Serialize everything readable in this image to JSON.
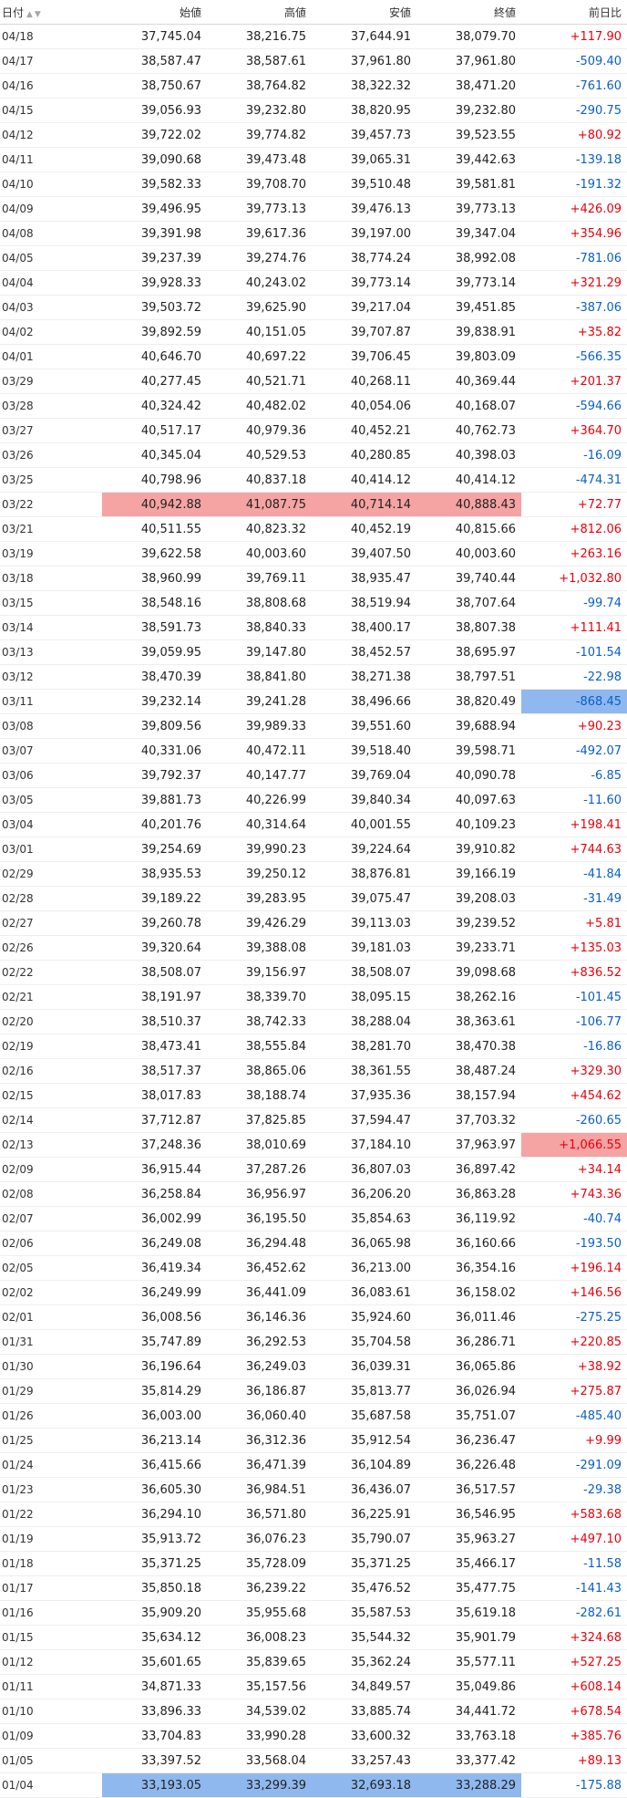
{
  "table": {
    "headers": {
      "date": "日付",
      "sort_icon": "▲▼",
      "open": "始値",
      "high": "高値",
      "low": "安値",
      "close": "終値",
      "change": "前日比"
    },
    "rows": [
      {
        "date": "04/18",
        "open": "37,745.04",
        "high": "38,216.75",
        "low": "37,644.91",
        "close": "38,079.70",
        "change": "+117.90"
      },
      {
        "date": "04/17",
        "open": "38,587.47",
        "high": "38,587.61",
        "low": "37,961.80",
        "close": "37,961.80",
        "change": "-509.40"
      },
      {
        "date": "04/16",
        "open": "38,750.67",
        "high": "38,764.82",
        "low": "38,322.32",
        "close": "38,471.20",
        "change": "-761.60"
      },
      {
        "date": "04/15",
        "open": "39,056.93",
        "high": "39,232.80",
        "low": "38,820.95",
        "close": "39,232.80",
        "change": "-290.75"
      },
      {
        "date": "04/12",
        "open": "39,722.02",
        "high": "39,774.82",
        "low": "39,457.73",
        "close": "39,523.55",
        "change": "+80.92"
      },
      {
        "date": "04/11",
        "open": "39,090.68",
        "high": "39,473.48",
        "low": "39,065.31",
        "close": "39,442.63",
        "change": "-139.18"
      },
      {
        "date": "04/10",
        "open": "39,582.33",
        "high": "39,708.70",
        "low": "39,510.48",
        "close": "39,581.81",
        "change": "-191.32"
      },
      {
        "date": "04/09",
        "open": "39,496.95",
        "high": "39,773.13",
        "low": "39,476.13",
        "close": "39,773.13",
        "change": "+426.09"
      },
      {
        "date": "04/08",
        "open": "39,391.98",
        "high": "39,617.36",
        "low": "39,197.00",
        "close": "39,347.04",
        "change": "+354.96"
      },
      {
        "date": "04/05",
        "open": "39,237.39",
        "high": "39,274.76",
        "low": "38,774.24",
        "close": "38,992.08",
        "change": "-781.06"
      },
      {
        "date": "04/04",
        "open": "39,928.33",
        "high": "40,243.02",
        "low": "39,773.14",
        "close": "39,773.14",
        "change": "+321.29"
      },
      {
        "date": "04/03",
        "open": "39,503.72",
        "high": "39,625.90",
        "low": "39,217.04",
        "close": "39,451.85",
        "change": "-387.06"
      },
      {
        "date": "04/02",
        "open": "39,892.59",
        "high": "40,151.05",
        "low": "39,707.87",
        "close": "39,838.91",
        "change": "+35.82"
      },
      {
        "date": "04/01",
        "open": "40,646.70",
        "high": "40,697.22",
        "low": "39,706.45",
        "close": "39,803.09",
        "change": "-566.35"
      },
      {
        "date": "03/29",
        "open": "40,277.45",
        "high": "40,521.71",
        "low": "40,268.11",
        "close": "40,369.44",
        "change": "+201.37"
      },
      {
        "date": "03/28",
        "open": "40,324.42",
        "high": "40,482.02",
        "low": "40,054.06",
        "close": "40,168.07",
        "change": "-594.66"
      },
      {
        "date": "03/27",
        "open": "40,517.17",
        "high": "40,979.36",
        "low": "40,452.21",
        "close": "40,762.73",
        "change": "+364.70"
      },
      {
        "date": "03/26",
        "open": "40,345.04",
        "high": "40,529.53",
        "low": "40,280.85",
        "close": "40,398.03",
        "change": "-16.09"
      },
      {
        "date": "03/25",
        "open": "40,798.96",
        "high": "40,837.18",
        "low": "40,414.12",
        "close": "40,414.12",
        "change": "-474.31"
      },
      {
        "date": "03/22",
        "open": "40,942.88",
        "high": "41,087.75",
        "low": "40,714.14",
        "close": "40,888.43",
        "change": "+72.77",
        "hl_ohlc": "red"
      },
      {
        "date": "03/21",
        "open": "40,511.55",
        "high": "40,823.32",
        "low": "40,452.19",
        "close": "40,815.66",
        "change": "+812.06"
      },
      {
        "date": "03/19",
        "open": "39,622.58",
        "high": "40,003.60",
        "low": "39,407.50",
        "close": "40,003.60",
        "change": "+263.16"
      },
      {
        "date": "03/18",
        "open": "38,960.99",
        "high": "39,769.11",
        "low": "38,935.47",
        "close": "39,740.44",
        "change": "+1,032.80"
      },
      {
        "date": "03/15",
        "open": "38,548.16",
        "high": "38,808.68",
        "low": "38,519.94",
        "close": "38,707.64",
        "change": "-99.74"
      },
      {
        "date": "03/14",
        "open": "38,591.73",
        "high": "38,840.33",
        "low": "38,400.17",
        "close": "38,807.38",
        "change": "+111.41"
      },
      {
        "date": "03/13",
        "open": "39,059.95",
        "high": "39,147.80",
        "low": "38,452.57",
        "close": "38,695.97",
        "change": "-101.54"
      },
      {
        "date": "03/12",
        "open": "38,470.39",
        "high": "38,841.80",
        "low": "38,271.38",
        "close": "38,797.51",
        "change": "-22.98"
      },
      {
        "date": "03/11",
        "open": "39,232.14",
        "high": "39,241.28",
        "low": "38,496.66",
        "close": "38,820.49",
        "change": "-868.45",
        "hl_change": "blue"
      },
      {
        "date": "03/08",
        "open": "39,809.56",
        "high": "39,989.33",
        "low": "39,551.60",
        "close": "39,688.94",
        "change": "+90.23"
      },
      {
        "date": "03/07",
        "open": "40,331.06",
        "high": "40,472.11",
        "low": "39,518.40",
        "close": "39,598.71",
        "change": "-492.07"
      },
      {
        "date": "03/06",
        "open": "39,792.37",
        "high": "40,147.77",
        "low": "39,769.04",
        "close": "40,090.78",
        "change": "-6.85"
      },
      {
        "date": "03/05",
        "open": "39,881.73",
        "high": "40,226.99",
        "low": "39,840.34",
        "close": "40,097.63",
        "change": "-11.60"
      },
      {
        "date": "03/04",
        "open": "40,201.76",
        "high": "40,314.64",
        "low": "40,001.55",
        "close": "40,109.23",
        "change": "+198.41"
      },
      {
        "date": "03/01",
        "open": "39,254.69",
        "high": "39,990.23",
        "low": "39,224.64",
        "close": "39,910.82",
        "change": "+744.63"
      },
      {
        "date": "02/29",
        "open": "38,935.53",
        "high": "39,250.12",
        "low": "38,876.81",
        "close": "39,166.19",
        "change": "-41.84"
      },
      {
        "date": "02/28",
        "open": "39,189.22",
        "high": "39,283.95",
        "low": "39,075.47",
        "close": "39,208.03",
        "change": "-31.49"
      },
      {
        "date": "02/27",
        "open": "39,260.78",
        "high": "39,426.29",
        "low": "39,113.03",
        "close": "39,239.52",
        "change": "+5.81"
      },
      {
        "date": "02/26",
        "open": "39,320.64",
        "high": "39,388.08",
        "low": "39,181.03",
        "close": "39,233.71",
        "change": "+135.03"
      },
      {
        "date": "02/22",
        "open": "38,508.07",
        "high": "39,156.97",
        "low": "38,508.07",
        "close": "39,098.68",
        "change": "+836.52"
      },
      {
        "date": "02/21",
        "open": "38,191.97",
        "high": "38,339.70",
        "low": "38,095.15",
        "close": "38,262.16",
        "change": "-101.45"
      },
      {
        "date": "02/20",
        "open": "38,510.37",
        "high": "38,742.33",
        "low": "38,288.04",
        "close": "38,363.61",
        "change": "-106.77"
      },
      {
        "date": "02/19",
        "open": "38,473.41",
        "high": "38,555.84",
        "low": "38,281.70",
        "close": "38,470.38",
        "change": "-16.86"
      },
      {
        "date": "02/16",
        "open": "38,517.37",
        "high": "38,865.06",
        "low": "38,361.55",
        "close": "38,487.24",
        "change": "+329.30"
      },
      {
        "date": "02/15",
        "open": "38,017.83",
        "high": "38,188.74",
        "low": "37,935.36",
        "close": "38,157.94",
        "change": "+454.62"
      },
      {
        "date": "02/14",
        "open": "37,712.87",
        "high": "37,825.85",
        "low": "37,594.47",
        "close": "37,703.32",
        "change": "-260.65"
      },
      {
        "date": "02/13",
        "open": "37,248.36",
        "high": "38,010.69",
        "low": "37,184.10",
        "close": "37,963.97",
        "change": "+1,066.55",
        "hl_change": "red"
      },
      {
        "date": "02/09",
        "open": "36,915.44",
        "high": "37,287.26",
        "low": "36,807.03",
        "close": "36,897.42",
        "change": "+34.14"
      },
      {
        "date": "02/08",
        "open": "36,258.84",
        "high": "36,956.97",
        "low": "36,206.20",
        "close": "36,863.28",
        "change": "+743.36"
      },
      {
        "date": "02/07",
        "open": "36,002.99",
        "high": "36,195.50",
        "low": "35,854.63",
        "close": "36,119.92",
        "change": "-40.74"
      },
      {
        "date": "02/06",
        "open": "36,249.08",
        "high": "36,294.48",
        "low": "36,065.98",
        "close": "36,160.66",
        "change": "-193.50"
      },
      {
        "date": "02/05",
        "open": "36,419.34",
        "high": "36,452.62",
        "low": "36,213.00",
        "close": "36,354.16",
        "change": "+196.14"
      },
      {
        "date": "02/02",
        "open": "36,249.99",
        "high": "36,441.09",
        "low": "36,083.61",
        "close": "36,158.02",
        "change": "+146.56"
      },
      {
        "date": "02/01",
        "open": "36,008.56",
        "high": "36,146.36",
        "low": "35,924.60",
        "close": "36,011.46",
        "change": "-275.25"
      },
      {
        "date": "01/31",
        "open": "35,747.89",
        "high": "36,292.53",
        "low": "35,704.58",
        "close": "36,286.71",
        "change": "+220.85"
      },
      {
        "date": "01/30",
        "open": "36,196.64",
        "high": "36,249.03",
        "low": "36,039.31",
        "close": "36,065.86",
        "change": "+38.92"
      },
      {
        "date": "01/29",
        "open": "35,814.29",
        "high": "36,186.87",
        "low": "35,813.77",
        "close": "36,026.94",
        "change": "+275.87"
      },
      {
        "date": "01/26",
        "open": "36,003.00",
        "high": "36,060.40",
        "low": "35,687.58",
        "close": "35,751.07",
        "change": "-485.40"
      },
      {
        "date": "01/25",
        "open": "36,213.14",
        "high": "36,312.36",
        "low": "35,912.54",
        "close": "36,236.47",
        "change": "+9.99"
      },
      {
        "date": "01/24",
        "open": "36,415.66",
        "high": "36,471.39",
        "low": "36,104.89",
        "close": "36,226.48",
        "change": "-291.09"
      },
      {
        "date": "01/23",
        "open": "36,605.30",
        "high": "36,984.51",
        "low": "36,436.07",
        "close": "36,517.57",
        "change": "-29.38"
      },
      {
        "date": "01/22",
        "open": "36,294.10",
        "high": "36,571.80",
        "low": "36,225.91",
        "close": "36,546.95",
        "change": "+583.68"
      },
      {
        "date": "01/19",
        "open": "35,913.72",
        "high": "36,076.23",
        "low": "35,790.07",
        "close": "35,963.27",
        "change": "+497.10"
      },
      {
        "date": "01/18",
        "open": "35,371.25",
        "high": "35,728.09",
        "low": "35,371.25",
        "close": "35,466.17",
        "change": "-11.58"
      },
      {
        "date": "01/17",
        "open": "35,850.18",
        "high": "36,239.22",
        "low": "35,476.52",
        "close": "35,477.75",
        "change": "-141.43"
      },
      {
        "date": "01/16",
        "open": "35,909.20",
        "high": "35,955.68",
        "low": "35,587.53",
        "close": "35,619.18",
        "change": "-282.61"
      },
      {
        "date": "01/15",
        "open": "35,634.12",
        "high": "36,008.23",
        "low": "35,544.32",
        "close": "35,901.79",
        "change": "+324.68"
      },
      {
        "date": "01/12",
        "open": "35,601.65",
        "high": "35,839.65",
        "low": "35,362.24",
        "close": "35,577.11",
        "change": "+527.25"
      },
      {
        "date": "01/11",
        "open": "34,871.33",
        "high": "35,157.56",
        "low": "34,849.57",
        "close": "35,049.86",
        "change": "+608.14"
      },
      {
        "date": "01/10",
        "open": "33,896.33",
        "high": "34,539.02",
        "low": "33,885.74",
        "close": "34,441.72",
        "change": "+678.54"
      },
      {
        "date": "01/09",
        "open": "33,704.83",
        "high": "33,990.28",
        "low": "33,600.32",
        "close": "33,763.18",
        "change": "+385.76"
      },
      {
        "date": "01/05",
        "open": "33,397.52",
        "high": "33,568.04",
        "low": "33,257.43",
        "close": "33,377.42",
        "change": "+89.13"
      },
      {
        "date": "01/04",
        "open": "33,193.05",
        "high": "33,299.39",
        "low": "32,693.18",
        "close": "33,288.29",
        "change": "-175.88",
        "hl_ohlc": "blue"
      }
    ]
  }
}
